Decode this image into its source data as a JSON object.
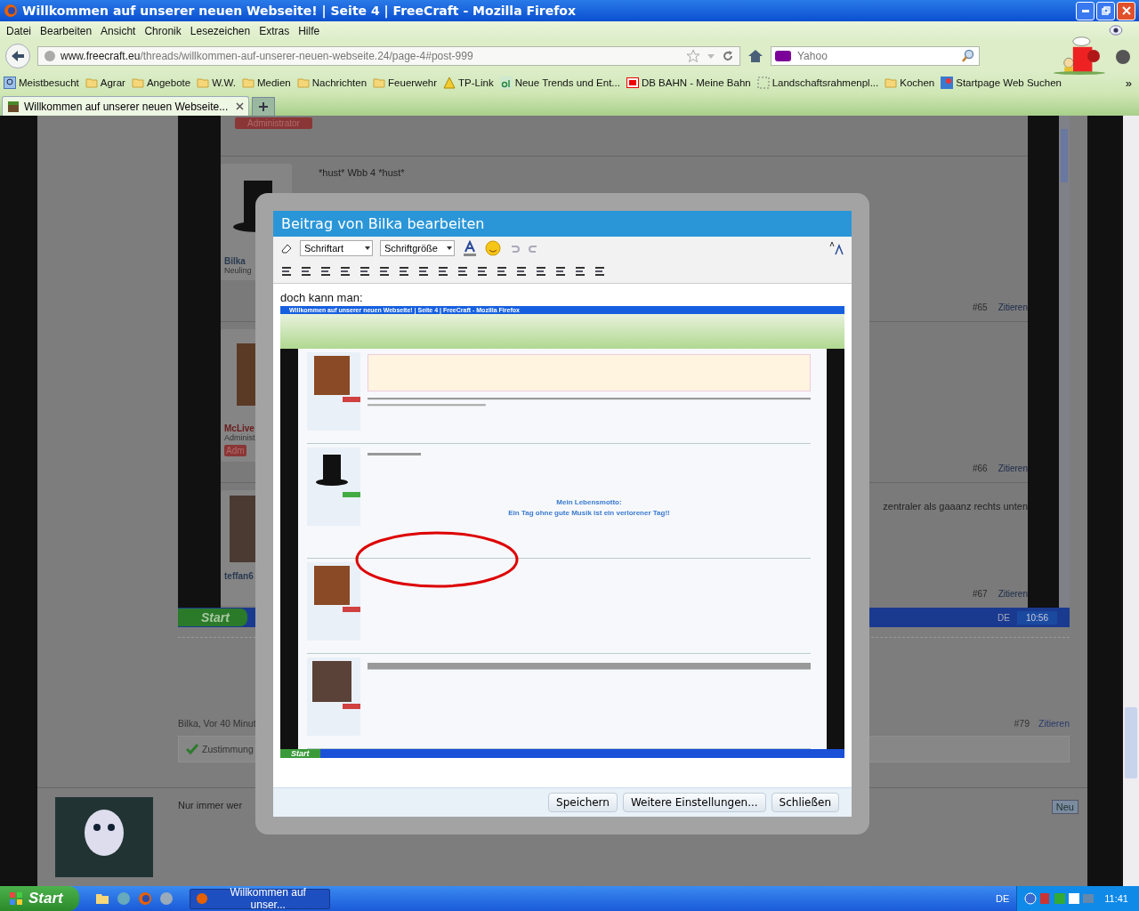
{
  "window": {
    "title": "Willkommen auf unserer neuen Webseite! | Seite 4 | FreeCraft - Mozilla Firefox"
  },
  "menu": [
    "Datei",
    "Bearbeiten",
    "Ansicht",
    "Chronik",
    "Lesezeichen",
    "Extras",
    "Hilfe"
  ],
  "address": {
    "host": "www.freecraft.eu",
    "path": "/threads/willkommen-auf-unserer-neuen-webseite.24/page-4#post-999"
  },
  "search": {
    "placeholder": "Yahoo"
  },
  "bookmarks": [
    {
      "label": "Meistbesucht",
      "kind": "search"
    },
    {
      "label": "Agrar",
      "kind": "folder"
    },
    {
      "label": "Angebote",
      "kind": "folder"
    },
    {
      "label": "W.W.",
      "kind": "folder"
    },
    {
      "label": "Medien",
      "kind": "folder"
    },
    {
      "label": "Nachrichten",
      "kind": "folder"
    },
    {
      "label": "Feuerwehr",
      "kind": "folder"
    },
    {
      "label": "TP-Link",
      "kind": "warning"
    },
    {
      "label": "Neue Trends und Ent...",
      "kind": "ah"
    },
    {
      "label": "DB BAHN - Meine Bahn",
      "kind": "db"
    },
    {
      "label": "Landschaftsrahmenpl...",
      "kind": "dashed"
    },
    {
      "label": "Kochen",
      "kind": "folder"
    },
    {
      "label": "Startpage Web Suchen",
      "kind": "sp"
    }
  ],
  "more_bookmarks": "»",
  "tabs": [
    {
      "label": "Willkommen auf unserer neuen Webseite...",
      "selected": true
    }
  ],
  "page": {
    "image": {
      "role": "Administrator",
      "post_text": "*hust* Wbb 4 *hust*",
      "user": "Bilka",
      "rank": "Neuling",
      "number_65": "#65",
      "quote_65": "Zitieren",
      "user_2": "McLive",
      "rank_2": "Administ",
      "role_2": "Adm",
      "number_66": "#66",
      "quote_66": "Zitieren",
      "text_67": "zentraler als gaaanz rechts unten",
      "user_3": "teffan6",
      "number_67": "#67",
      "quote_67": "Zitieren",
      "start": "Start",
      "lang": "DE",
      "time": "10:56"
    },
    "footer": {
      "meta": "Bilka, Vor 40 Minut",
      "number": "#79",
      "quote": "Zitieren",
      "like": "Zustimmung"
    },
    "next_post": {
      "text": "Nur immer wer",
      "badge": "Neu"
    }
  },
  "dialog": {
    "title": "Beitrag von Bilka bearbeiten",
    "font": "Schriftart",
    "size": "Schriftgröße",
    "text": "doch kann man:",
    "screenshot": {
      "title": "Willkommen auf unserer neuen Webseite! | Seite 4 | FreeCraft - Mozilla Firefox",
      "motto_title": "Mein Lebensmotto:",
      "motto": "Ein Tag ohne gute Musik ist ein verlorener Tag!!",
      "start": "Start"
    },
    "buttons": [
      "Speichern",
      "Weitere Einstellungen...",
      "Schließen"
    ]
  },
  "taskbar": {
    "start": "Start",
    "task": "Willkommen auf unser...",
    "lang": "DE",
    "time": "11:41"
  }
}
